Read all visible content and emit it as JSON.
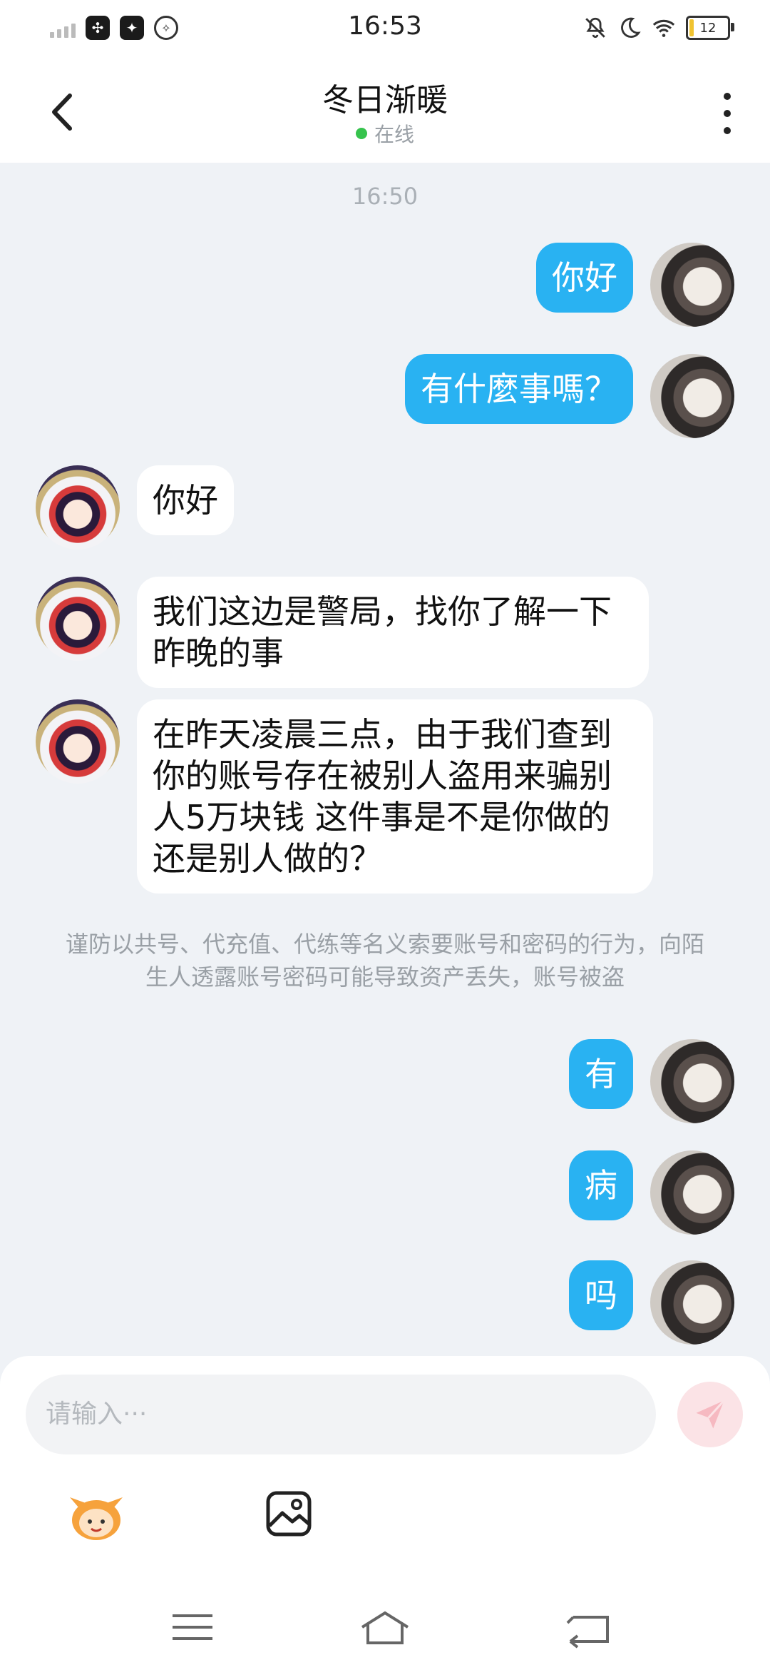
{
  "status_bar": {
    "time": "16:53",
    "battery": "12",
    "battery_level": 0.12,
    "left_icons": [
      "signal-icon",
      "app-icon-1",
      "app-icon-2",
      "app-icon-3"
    ],
    "right_icons": [
      "mute-icon",
      "moon-icon",
      "wifi-icon",
      "battery-icon"
    ]
  },
  "header": {
    "title": "冬日渐暖",
    "presence": "在线",
    "presence_color": "#36c34d"
  },
  "chat": {
    "timestamp": "16:50",
    "messages": [
      {
        "from": "me",
        "text": "你好"
      },
      {
        "from": "me",
        "text": "有什麼事嗎？"
      },
      {
        "from": "other",
        "text": "你好"
      },
      {
        "from": "other",
        "text": "我们这边是警局，找你了解一下昨晚的事"
      },
      {
        "from": "other",
        "text": "在昨天凌晨三点，由于我们查到你的账号存在被别人盗用来骗别人5万块钱 这件事是不是你做的还是别人做的？"
      }
    ],
    "notice": "谨防以共号、代充值、代练等名义索要账号和密码的行为，向陌生人透露账号密码可能导致资产丢失，账号被盗",
    "later_messages": [
      {
        "from": "me",
        "text": "有"
      },
      {
        "from": "me",
        "text": "病"
      },
      {
        "from": "me",
        "text": "吗"
      }
    ]
  },
  "input": {
    "placeholder": "请输入···"
  },
  "colors": {
    "accent": "#29b2f2",
    "background": "#eff2f6",
    "send_disabled": "#fbe3e6"
  }
}
